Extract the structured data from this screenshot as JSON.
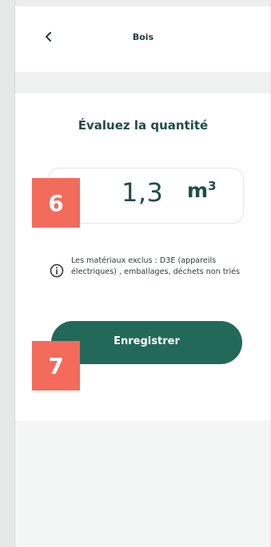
{
  "header": {
    "title": "Bois",
    "back_icon": "chevron-left-icon"
  },
  "quantity": {
    "heading": "Évaluez la quantité",
    "value": "1,3",
    "unit": "m",
    "unit_exponent": "3"
  },
  "info": {
    "icon": "info-icon",
    "text": "Les matériaux exclus : D3E (appareils électriques) , emballages, déchets non triés"
  },
  "actions": {
    "save_label": "Enregistrer"
  },
  "annotations": {
    "badge_1": "6",
    "badge_2": "7"
  },
  "colors": {
    "primary": "#23695a",
    "text_dark": "#1f4e45",
    "badge": "#f36b5b",
    "background": "#f4f5f5"
  }
}
